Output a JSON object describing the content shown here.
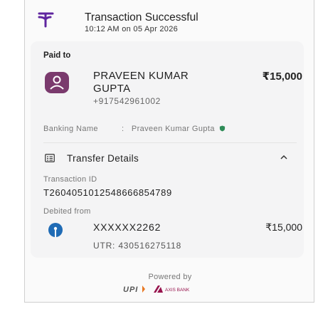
{
  "header": {
    "title": "Transaction Successful",
    "subtitle": "10:12 AM on 05 Apr 2026",
    "logo_icon": "phonepe-logo-icon",
    "logo_color": "#5f259f"
  },
  "payee": {
    "section_label": "Paid to",
    "avatar_icon": "user-avatar-icon",
    "avatar_color": "#7a3a6d",
    "name": "PRAVEEN KUMAR GUPTA",
    "amount": "₹15,000",
    "phone": "+917542961002"
  },
  "banking": {
    "label": "Banking Name",
    "separator": ":",
    "value": "Praveen Kumar Gupta",
    "verified_icon": "verified-shield-icon",
    "value_color": "#7a7a7a"
  },
  "transfer_details": {
    "icon": "list-details-icon",
    "label": "Transfer Details",
    "chevron_icon": "chevron-up-icon",
    "transaction_id_label": "Transaction ID",
    "transaction_id": "T2604051012548666854789",
    "debited_label": "Debited from",
    "bank_icon": "sbi-bank-logo-icon",
    "account": "XXXXXX2262",
    "account_amount": "₹15,000",
    "utr": "UTR: 430516275118"
  },
  "footer": {
    "powered_by": "Powered by",
    "upi_logo": "UPI",
    "partner_logo": "AXIS BANK"
  }
}
